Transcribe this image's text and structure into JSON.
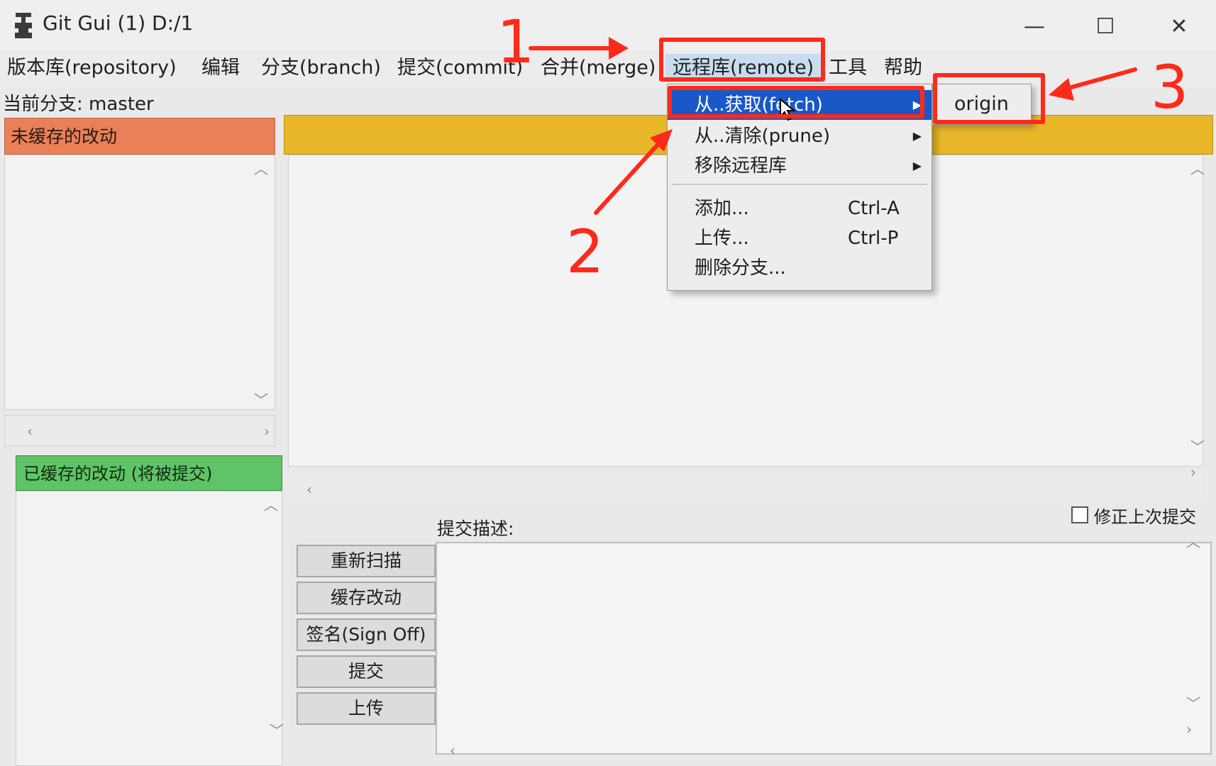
{
  "window": {
    "title": "Git Gui (1) D:/1",
    "icon": "git-gui-icon",
    "controls": [
      "minimize-icon",
      "maximize-icon",
      "close-icon"
    ],
    "minimize_glyph": "—",
    "maximize_glyph": "☐",
    "close_glyph": "✕"
  },
  "menubar": {
    "items": [
      {
        "label": "版本库(repository)"
      },
      {
        "label": "编辑"
      },
      {
        "label": "分支(branch)"
      },
      {
        "label": "提交(commit)"
      },
      {
        "label": "合并(merge)"
      },
      {
        "label": "远程库(remote)"
      },
      {
        "label": "工具"
      },
      {
        "label": "帮助"
      }
    ]
  },
  "branch": {
    "label": "当前分支: master"
  },
  "unstaged": {
    "header": "未缓存的改动"
  },
  "staged": {
    "header": "已缓存的改动 (将被提交)"
  },
  "commit": {
    "description_label": "提交描述:",
    "amend_label": "修正上次提交",
    "amend_checked": false,
    "buttons": [
      {
        "label": "重新扫描"
      },
      {
        "label": "缓存改动"
      },
      {
        "label": "签名(Sign Off)"
      },
      {
        "label": "提交"
      },
      {
        "label": "上传"
      }
    ]
  },
  "remote_menu": {
    "items": [
      {
        "label": "从..获取(fetch)",
        "submenu": true,
        "active": true
      },
      {
        "label": "从..清除(prune)",
        "submenu": true
      },
      {
        "label": "移除远程库",
        "submenu": true
      },
      {
        "label": "添加...",
        "shortcut": "Ctrl-A"
      },
      {
        "label": "上传...",
        "shortcut": "Ctrl-P"
      },
      {
        "label": "删除分支..."
      }
    ],
    "submenu_item": "origin"
  },
  "annotations": {
    "step1": "1",
    "step2": "2",
    "step3": "3",
    "color": "#ff2a1a"
  },
  "colors": {
    "unstaged": "#e98058",
    "staged": "#5fc467",
    "diff_header": "#e8b72a",
    "menu_highlight": "#1958c7"
  }
}
